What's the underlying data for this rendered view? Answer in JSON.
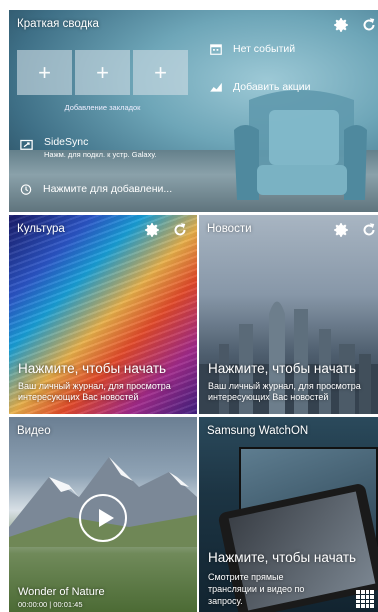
{
  "summary": {
    "title": "Краткая сводка",
    "bookmarks": [
      "+",
      "+",
      "+"
    ],
    "bookmarks_label": "Добавление закладок",
    "events": "Нет событий",
    "add_deals": "Добавить акции",
    "sidesync_title": "SideSync",
    "sidesync_sub": "Нажм. для подкл. к устр. Galaxy.",
    "reminder": "Нажмите для добавлени..."
  },
  "culture": {
    "title": "Культура",
    "cta": "Нажмите, чтобы начать",
    "desc1": "Ваш личный журнал, для просмотра",
    "desc2": "интересующих Вас новостей"
  },
  "news": {
    "title": "Новости",
    "cta": "Нажмите, чтобы начать",
    "desc1": "Ваш личный журнал, для просмотра",
    "desc2": "интересующих Вас новостей"
  },
  "video": {
    "title": "Видео",
    "name": "Wonder of Nature",
    "time": "00:00:00 | 00:01:45"
  },
  "watchon": {
    "title": "Samsung WatchON",
    "cta": "Нажмите, чтобы начать",
    "desc1": "Смотрите прямые",
    "desc2": "трансляции и видео по",
    "desc3": "запросу."
  },
  "icons": {
    "settings": "gear-icon",
    "refresh": "refresh-icon",
    "calendar": "calendar-icon",
    "stocks": "chart-icon",
    "sidesync": "sidesync-icon",
    "alarm": "alarm-icon",
    "apps": "apps-grid-icon"
  }
}
